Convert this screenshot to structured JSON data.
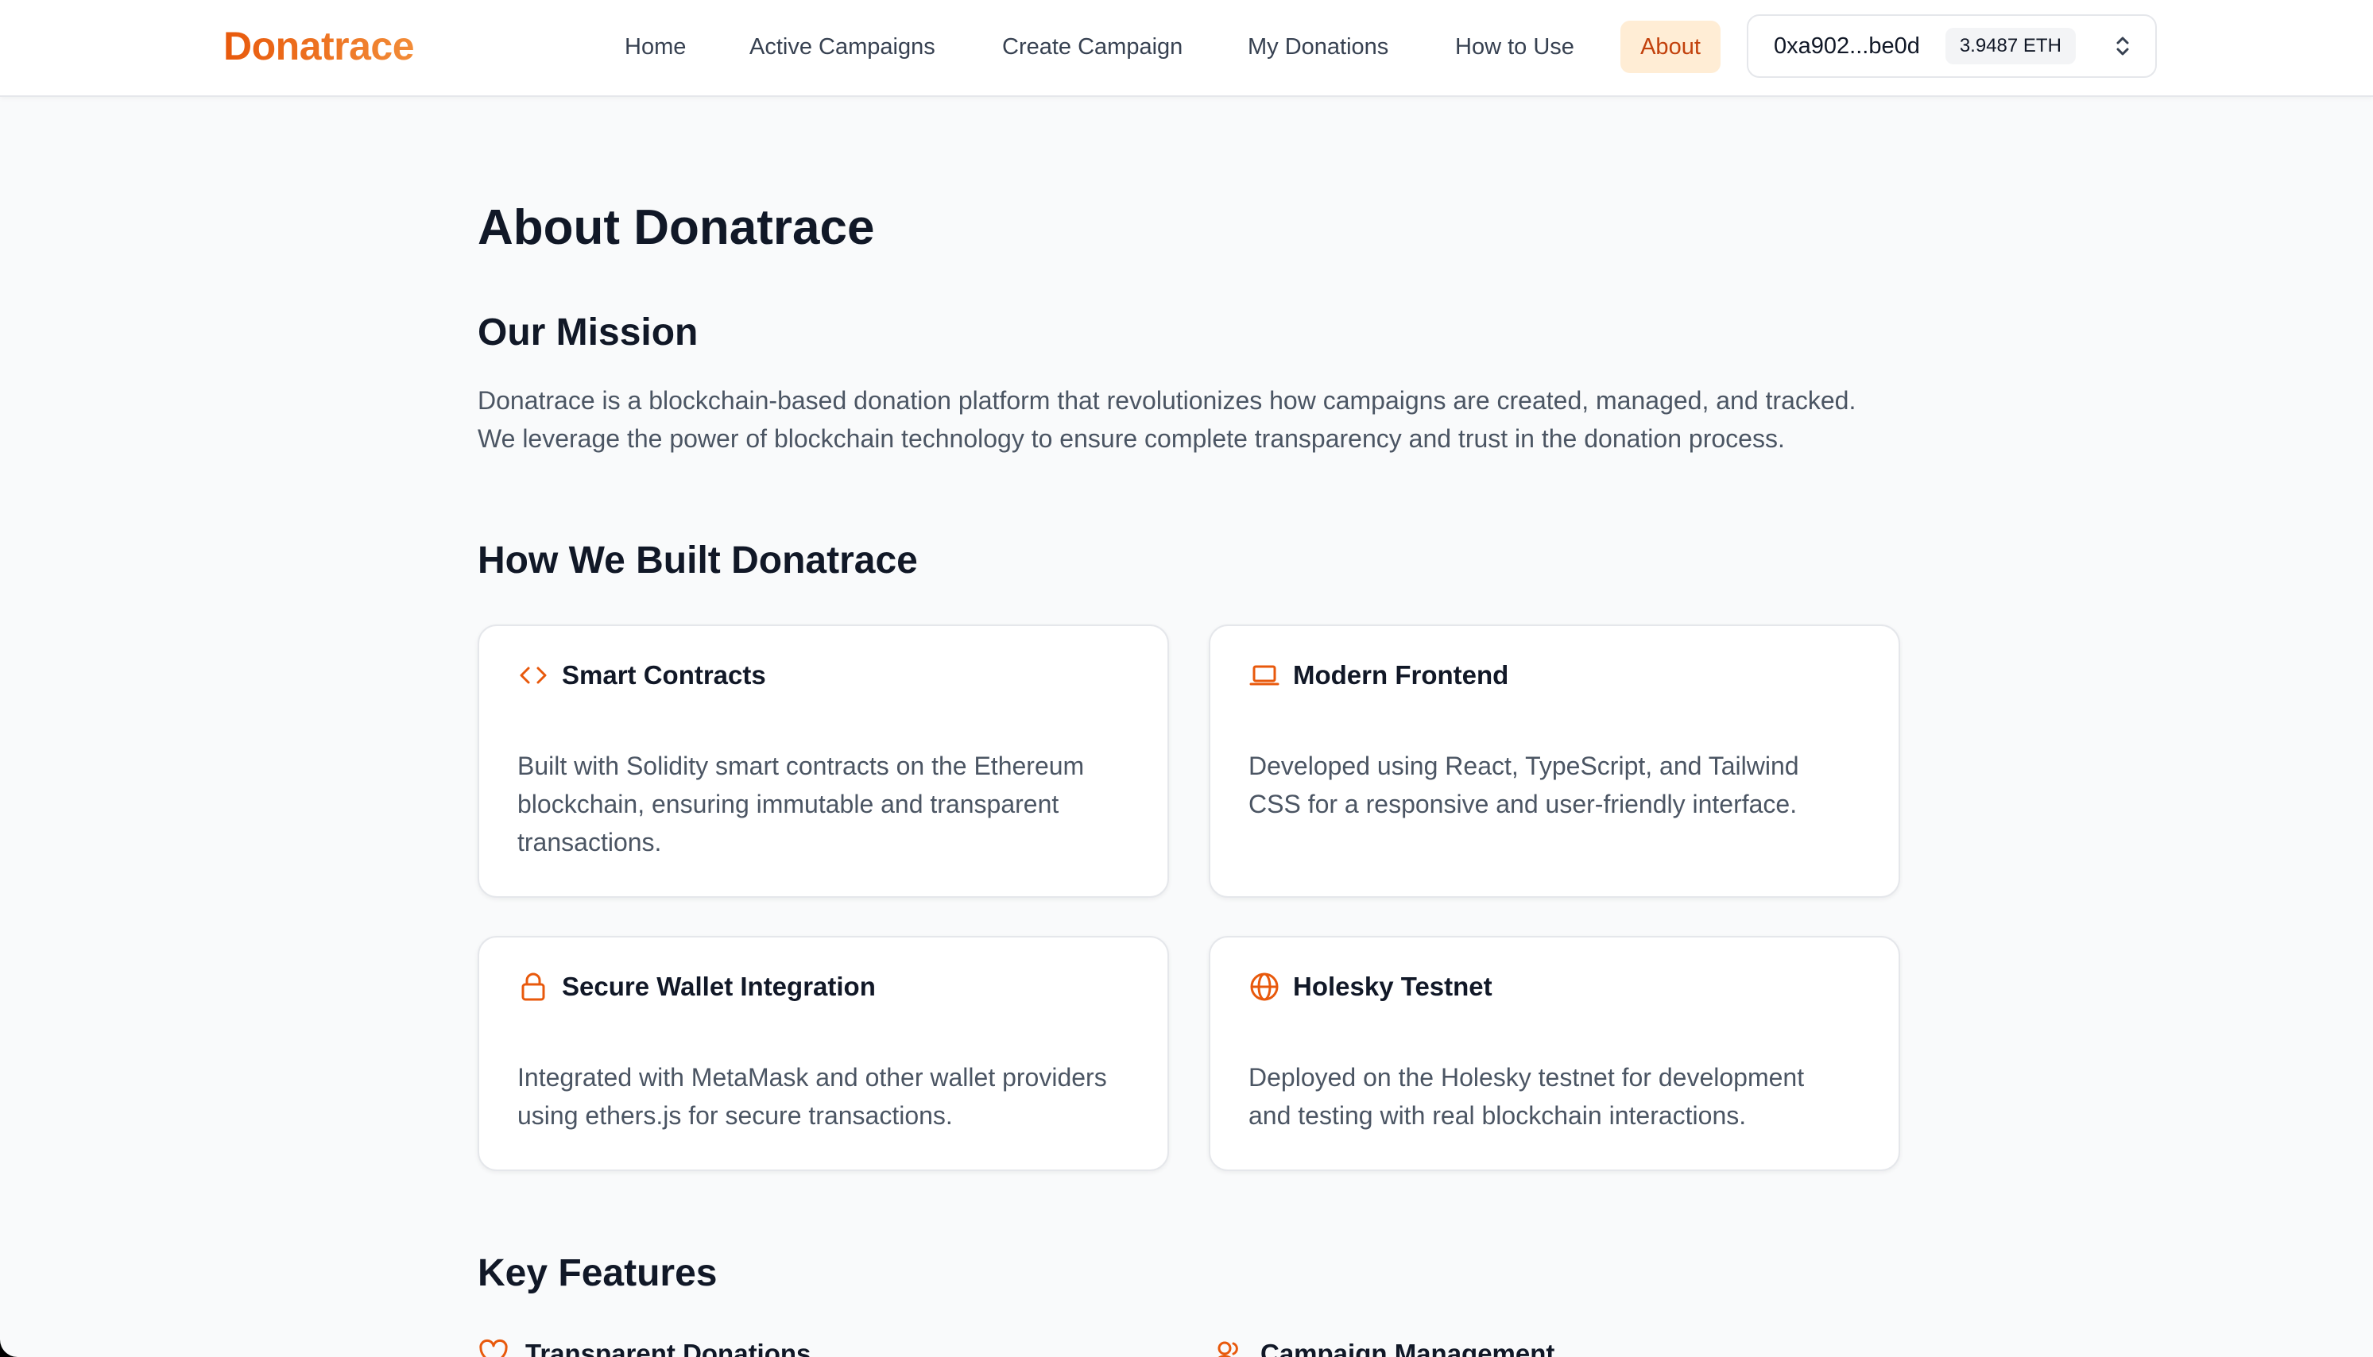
{
  "header": {
    "logo": "Donatrace",
    "nav": [
      {
        "label": "Home"
      },
      {
        "label": "Active Campaigns"
      },
      {
        "label": "Create Campaign"
      },
      {
        "label": "My Donations"
      },
      {
        "label": "How to Use"
      },
      {
        "label": "About",
        "active": true
      }
    ],
    "wallet": {
      "address": "0xa902...be0d",
      "balance": "3.9487 ETH",
      "icon": "chevron-up-down-icon"
    }
  },
  "main": {
    "title": "About Donatrace",
    "mission": {
      "heading": "Our Mission",
      "text_line1": "Donatrace is a blockchain-based donation platform that revolutionizes how campaigns are created, managed, and tracked.",
      "text_line2": "We leverage the power of blockchain technology to ensure complete transparency and trust in the donation process."
    },
    "built": {
      "heading": "How We Built Donatrace",
      "cards": [
        {
          "icon": "code-icon",
          "title": "Smart Contracts",
          "desc_lines": [
            "Built with Solidity smart contracts on the Ethereum",
            "blockchain, ensuring immutable and transparent",
            "transactions."
          ]
        },
        {
          "icon": "laptop-icon",
          "title": "Modern Frontend",
          "desc_lines": [
            "Developed using React, TypeScript, and Tailwind",
            "CSS for a responsive and user-friendly interface."
          ]
        },
        {
          "icon": "lock-icon",
          "title": "Secure Wallet Integration",
          "desc_lines": [
            "Integrated with MetaMask and other wallet providers",
            "using ethers.js for secure transactions."
          ]
        },
        {
          "icon": "globe-icon",
          "title": "Holesky Testnet",
          "desc_lines": [
            "Deployed on the Holesky testnet for development",
            "and testing with real blockchain interactions."
          ]
        }
      ]
    },
    "features": {
      "heading": "Key Features",
      "items": [
        {
          "icon": "heart-icon",
          "title": "Transparent Donations"
        },
        {
          "icon": "users-icon",
          "title": "Campaign Management"
        }
      ]
    }
  },
  "colors": {
    "accent": "#e8590c",
    "active_bg": "#ffedd5",
    "text": "#111827",
    "muted": "#4b5563",
    "page_bg": "#f9fafb"
  }
}
